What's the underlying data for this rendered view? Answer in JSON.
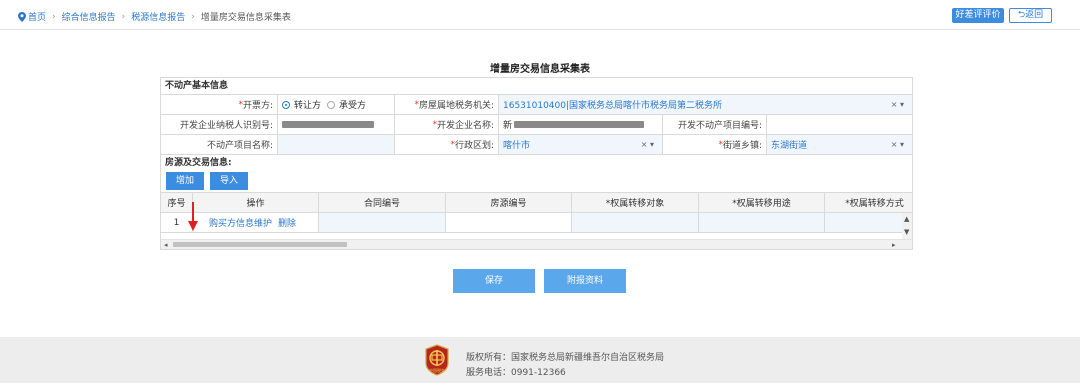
{
  "breadcrumb": {
    "home": "首页",
    "items": [
      "综合信息报告",
      "税源信息报告"
    ],
    "current": "增量房交易信息采集表"
  },
  "header": {
    "rate_label": "好差评评价",
    "back_label": "返回"
  },
  "page_title": "增量房交易信息采集表",
  "section_basic": "不动产基本信息",
  "fields": {
    "issuer_label": "开票方:",
    "issuer_options": [
      "转让方",
      "承受方"
    ],
    "tax_office_label": "房屋属地税务机关:",
    "tax_office_value": "16531010400|国家税务总局喀什市税务局第二税务所",
    "taxpayer_id_label": "开发企业纳税人识别号:",
    "company_name_label": "开发企业名称:",
    "company_name_prefix": "新",
    "project_no_label": "开发不动产项目编号:",
    "project_name_label": "不动产项目名称:",
    "district_label": "行政区划:",
    "district_value": "喀什市",
    "street_label": "街道乡镇:",
    "street_value": "东湖街道"
  },
  "section_trade": "房源及交易信息:",
  "trade_buttons": {
    "add": "增加",
    "import": "导入"
  },
  "grid": {
    "columns": [
      "序号",
      "操作",
      "合同编号",
      "房源编号",
      "*权属转移对象",
      "*权属转移用途",
      "*权属转移方式"
    ],
    "rows": [
      {
        "index": "1",
        "action_edit": "购买方信息维护",
        "action_delete": "删除"
      }
    ]
  },
  "actions": {
    "save": "保存",
    "attach": "附报资料"
  },
  "footer": {
    "copyright": "版权所有：国家税务总局新疆维吾尔自治区税务局",
    "phone": "服务电话：0991-12366",
    "logo_text": "中国税务"
  },
  "colors": {
    "accent": "#3c8cdf",
    "required": "#e53935",
    "link": "#2a77c9"
  }
}
